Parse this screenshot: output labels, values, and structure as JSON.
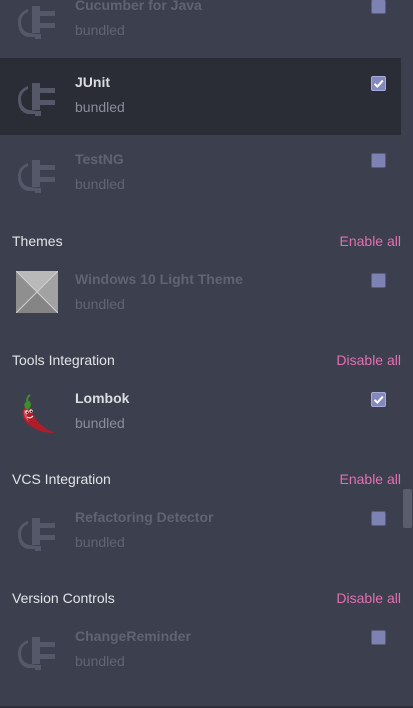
{
  "plugins": {
    "cucumber": {
      "name": "Cucumber for Java",
      "sub": "bundled",
      "checked": false,
      "icon": "plug-icon"
    },
    "junit": {
      "name": "JUnit",
      "sub": "bundled",
      "checked": true,
      "icon": "plug-icon"
    },
    "testng": {
      "name": "TestNG",
      "sub": "bundled",
      "checked": false,
      "icon": "plug-icon"
    },
    "win10": {
      "name": "Windows 10 Light Theme",
      "sub": "bundled",
      "checked": false,
      "icon": "theme-icon"
    },
    "lombok": {
      "name": "Lombok",
      "sub": "bundled",
      "checked": true,
      "icon": "chili-pepper-icon"
    },
    "refactoring": {
      "name": "Refactoring Detector",
      "sub": "bundled",
      "checked": false,
      "icon": "plug-icon"
    },
    "changereminder": {
      "name": "ChangeReminder",
      "sub": "bundled",
      "checked": false,
      "icon": "plug-icon"
    }
  },
  "groups": {
    "themes": {
      "title": "Themes",
      "action": "Enable all"
    },
    "tools": {
      "title": "Tools Integration",
      "action": "Disable all"
    },
    "vcs": {
      "title": "VCS Integration",
      "action": "Enable all"
    },
    "version": {
      "title": "Version Controls",
      "action": "Disable all"
    }
  },
  "colors": {
    "background": "#3c3f4d",
    "selected_row": "#2a2c36",
    "link": "#e46fb2",
    "checkbox": "#7e82b3"
  }
}
